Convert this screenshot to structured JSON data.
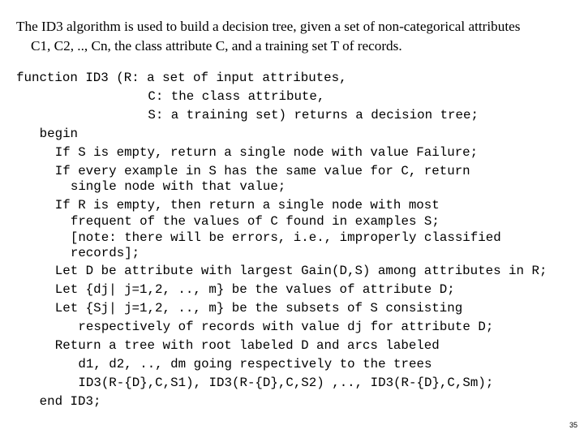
{
  "intro": {
    "line1": "The ID3 algorithm is used to build a decision tree, given a set of non-categorical attributes",
    "line2": "C1, C2, .., Cn, the class attribute C, and a training set T of records."
  },
  "code": [
    {
      "indent": 0,
      "text": "function ID3 (R: a set of input attributes,"
    },
    {
      "indent": 17,
      "text": "C: the class attribute,"
    },
    {
      "indent": 17,
      "text": "S: a training set) returns a decision tree;"
    },
    {
      "indent": 3,
      "text": "begin"
    },
    {
      "indent": 5,
      "text": "If S is empty, return a single node with value Failure;"
    },
    {
      "indent": 5,
      "text": "If every example in S has the same value for C, return"
    },
    {
      "indent": 7,
      "text": "single node with that value;"
    },
    {
      "indent": 5,
      "text": "If R is empty, then return a single node with most"
    },
    {
      "indent": 7,
      "text": "frequent of the values of C found in examples S;"
    },
    {
      "indent": 7,
      "text": "[note: there will be errors, i.e., improperly classified"
    },
    {
      "indent": 7,
      "text": "records];"
    },
    {
      "indent": 5,
      "text": "Let D be attribute with largest Gain(D,S) among attributes in R;"
    },
    {
      "indent": 5,
      "text": "Let {dj| j=1,2, .., m} be the values of attribute D;"
    },
    {
      "indent": 5,
      "text": "Let {Sj| j=1,2, .., m} be the subsets of S consisting"
    },
    {
      "indent": 8,
      "text": "respectively of records with value dj for attribute D;"
    },
    {
      "indent": 5,
      "text": "Return a tree with root labeled D and arcs labeled"
    },
    {
      "indent": 8,
      "text": "d1, d2, .., dm going respectively to the trees"
    },
    {
      "indent": 8,
      "text": "ID3(R-{D},C,S1), ID3(R-{D},C,S2) ,.., ID3(R-{D},C,Sm);"
    },
    {
      "indent": 3,
      "text": "end ID3;"
    }
  ],
  "page_number": "35"
}
